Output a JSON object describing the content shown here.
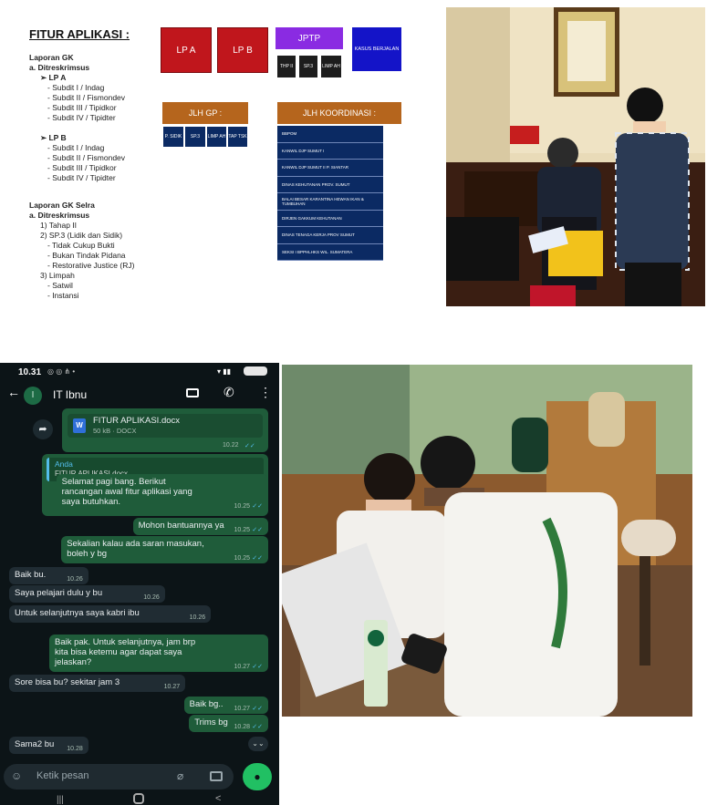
{
  "slide": {
    "title": "FITUR APLIKASI :",
    "lines": [
      {
        "text": "Laporan GK",
        "bold": true
      },
      {
        "text": "a.  Ditreskrimsus",
        "bold": true
      },
      {
        "text": "➢  LP A",
        "bold": true
      },
      {
        "text": "-    Subdit I / Indag",
        "bold": false
      },
      {
        "text": "-    Subdit II / Fismondev",
        "bold": false
      },
      {
        "text": "-    Subdit III / Tipidkor",
        "bold": false
      },
      {
        "text": "-    Subdit IV / Tipidter",
        "bold": false
      },
      {
        "text": "➢  LP B",
        "bold": true
      },
      {
        "text": "-    Subdit I / Indag",
        "bold": false
      },
      {
        "text": "-    Subdit II / Fismondev",
        "bold": false
      },
      {
        "text": "-    Subdit III / Tipidkor",
        "bold": false
      },
      {
        "text": "-    Subdit IV / Tipidter",
        "bold": false
      },
      {
        "text": "Laporan GK Selra",
        "bold": true
      },
      {
        "text": "a.  Ditreskrimsus",
        "bold": true
      },
      {
        "text": "1)  Tahap II",
        "bold": false
      },
      {
        "text": "2)  SP.3 (Lidik dan Sidik)",
        "bold": false
      },
      {
        "text": "-    Tidak Cukup Bukti",
        "bold": false
      },
      {
        "text": "-    Bukan Tindak Pidana",
        "bold": false
      },
      {
        "text": "-    Restorative Justice (RJ)",
        "bold": false
      },
      {
        "text": "3)  Limpah",
        "bold": false
      },
      {
        "text": "-    Satwil",
        "bold": false
      },
      {
        "text": "-    Instansi",
        "bold": false
      }
    ],
    "lp_a": "LP A",
    "lp_b": "LP B",
    "jtp": "JPTP",
    "jtp_sub": [
      "THP II",
      "SP.3",
      "LIMP AH"
    ],
    "kasus": "KASUS BERJALAN",
    "jlh_gp": "JLH GP :",
    "jlh_gp_sub": [
      "P. SIDIK",
      "SP.3",
      "LIMP AH",
      "TAP TSK"
    ],
    "jlh_koord": "JLH KOORDINASI :",
    "koord_items": [
      "BBPOM",
      "KANWIL DJP SUMUT I",
      "KANWIL DJP SUMUT II P. SIANTAR",
      "DINAS KEHUTANAN PROV. SUMUT",
      "BALAI BESAR KARANTINA HEWAN IKAN & TUMBUHAN",
      "DIRJEN GAKKUM KEHUTANAN",
      "DINAS TENAGA KERJA PROV SUMUT",
      "SEKSI I BPPHLHKS WIL. SUMATERA"
    ]
  },
  "phone": {
    "status_time": "10.31",
    "contact_name": "IT Ibnu",
    "avatar_letter": "I",
    "doc_name": "FITUR APLIKASI.docx",
    "doc_meta": "50 kB · DOCX",
    "doc_time": "10.22",
    "reply_author": "Anda",
    "reply_file": "FITUR APLIKASI.docx",
    "messages": [
      {
        "text": "Selamat pagi bang. Berikut\nrancangan awal fitur aplikasi yang\nsaya butuhkan.",
        "time": "10.25",
        "dir": "out"
      },
      {
        "text": "Mohon bantuannya ya",
        "time": "10.25",
        "dir": "out"
      },
      {
        "text": "Sekalian kalau ada saran masukan,\nboleh y bg",
        "time": "10.25",
        "dir": "out"
      },
      {
        "text": "Baik bu.",
        "time": "10.26",
        "dir": "in"
      },
      {
        "text": "Saya pelajari dulu y bu",
        "time": "10.26",
        "dir": "in"
      },
      {
        "text": "Untuk selanjutnya saya kabri ibu",
        "time": "10.26",
        "dir": "in"
      },
      {
        "text": "Baik pak. Untuk selanjutnya, jam brp\nkita bisa ketemu agar dapat saya\njelaskan?",
        "time": "10.27",
        "dir": "out"
      },
      {
        "text": "Sore bisa bu? sekitar jam 3",
        "time": "10.27",
        "dir": "in"
      },
      {
        "text": "Baik bg..",
        "time": "10.27",
        "dir": "out"
      },
      {
        "text": "Trims bg",
        "time": "10.28",
        "dir": "out"
      },
      {
        "text": "Sama2 bu",
        "time": "10.28",
        "dir": "in"
      }
    ],
    "input_placeholder": "Ketik pesan"
  },
  "colors": {
    "wa_green": "#21c063",
    "out_bubble": "#1f5c3a",
    "in_bubble": "#202c33",
    "slide_red": "#c0161c",
    "slide_navy": "#0b2a63"
  }
}
